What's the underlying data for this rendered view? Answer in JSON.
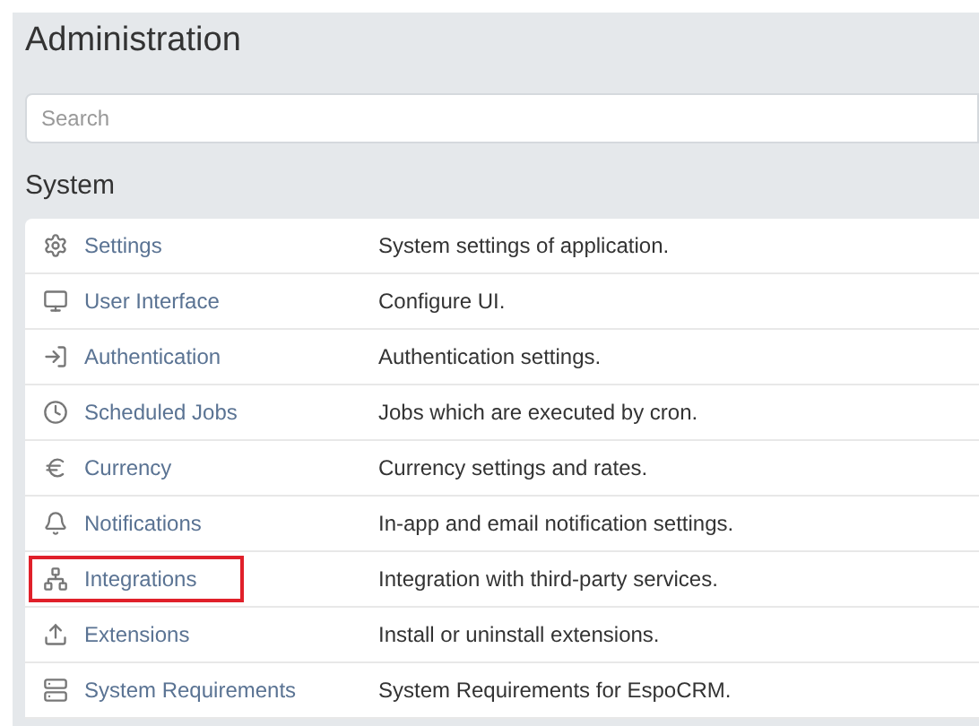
{
  "page_title": "Administration",
  "search": {
    "placeholder": "Search"
  },
  "section_title": "System",
  "items": [
    {
      "label": "Settings",
      "description": "System settings of application.",
      "highlighted": false
    },
    {
      "label": "User Interface",
      "description": "Configure UI.",
      "highlighted": false
    },
    {
      "label": "Authentication",
      "description": "Authentication settings.",
      "highlighted": false
    },
    {
      "label": "Scheduled Jobs",
      "description": "Jobs which are executed by cron.",
      "highlighted": false
    },
    {
      "label": "Currency",
      "description": "Currency settings and rates.",
      "highlighted": false
    },
    {
      "label": "Notifications",
      "description": "In-app and email notification settings.",
      "highlighted": false
    },
    {
      "label": "Integrations",
      "description": "Integration with third-party services.",
      "highlighted": true
    },
    {
      "label": "Extensions",
      "description": "Install or uninstall extensions.",
      "highlighted": false
    },
    {
      "label": "System Requirements",
      "description": "System Requirements for EspoCRM.",
      "highlighted": false
    }
  ]
}
